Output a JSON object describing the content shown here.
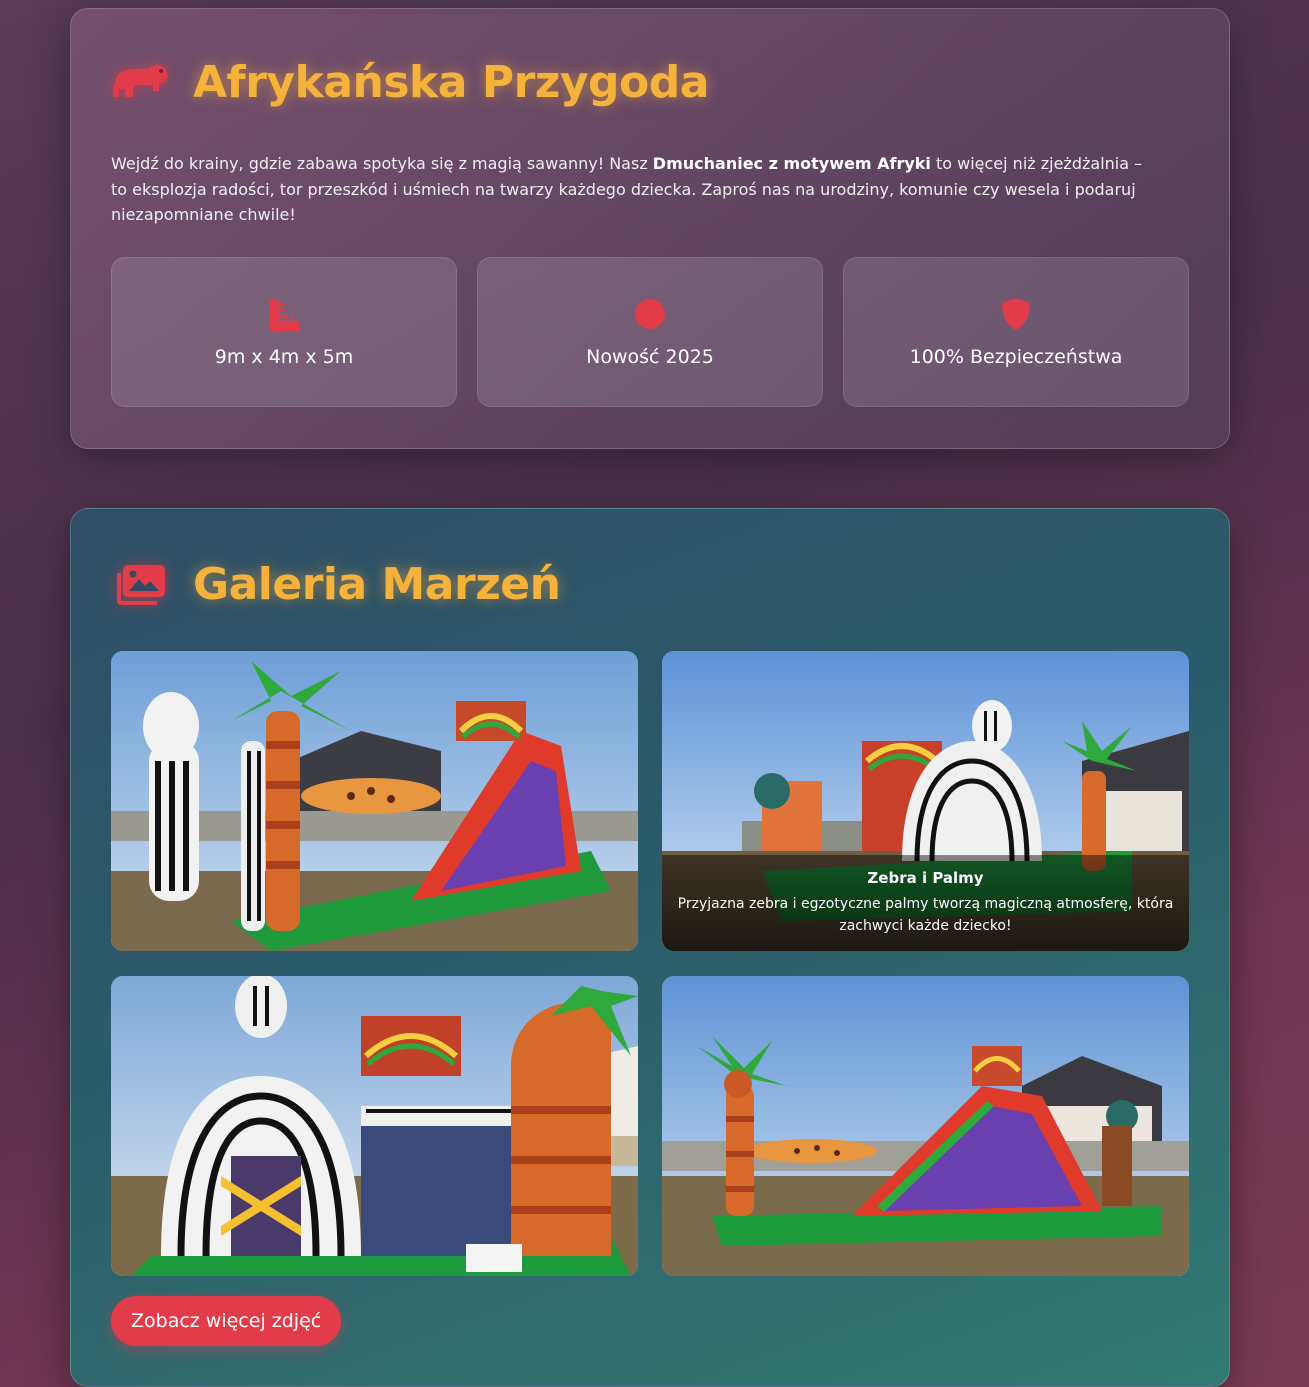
{
  "intro": {
    "title": "Afrykańska Przygoda",
    "icon": "hippo-icon",
    "description_part1": "Wejdź do krainy, gdzie zabawa spotyka się z magią sawanny! Nasz ",
    "description_bold": "Dmuchaniec z motywem Afryki",
    "description_part2": " to więcej niż zjeżdżalnia – to eksplozja radości, tor przeszkód i uśmiech na twarzy każdego dziecka. Zaproś nas na urodziny, komunie czy wesela i podaruj niezapomniane chwile!",
    "features": [
      {
        "icon": "ruler-combined-icon",
        "label": "9m x 4m x 5m"
      },
      {
        "icon": "star-icon",
        "label": "Nowość 2025"
      },
      {
        "icon": "shield-icon",
        "label": "100% Bezpieczeństwa"
      }
    ]
  },
  "gallery": {
    "title": "Galeria Marzeń",
    "icon": "images-icon",
    "photos": [
      {
        "alt": "Zebra, palma i zjeżdżalnia"
      },
      {
        "alt": "Zebra i Palmy",
        "caption_title": "Zebra i Palmy",
        "caption_desc": "Przyjazna zebra i egzotyczne palmy tworzą magiczną atmosferę, która zachwyci każde dziecko!"
      },
      {
        "alt": "Wejście przez zebrę"
      },
      {
        "alt": "Zjeżdżalnia z palmą"
      }
    ],
    "more_button": "Zobacz więcej zdjęć"
  },
  "colors": {
    "accent_title": "#f6b23a",
    "accent_icon": "#e23c4a",
    "button": "#e23c4a"
  }
}
